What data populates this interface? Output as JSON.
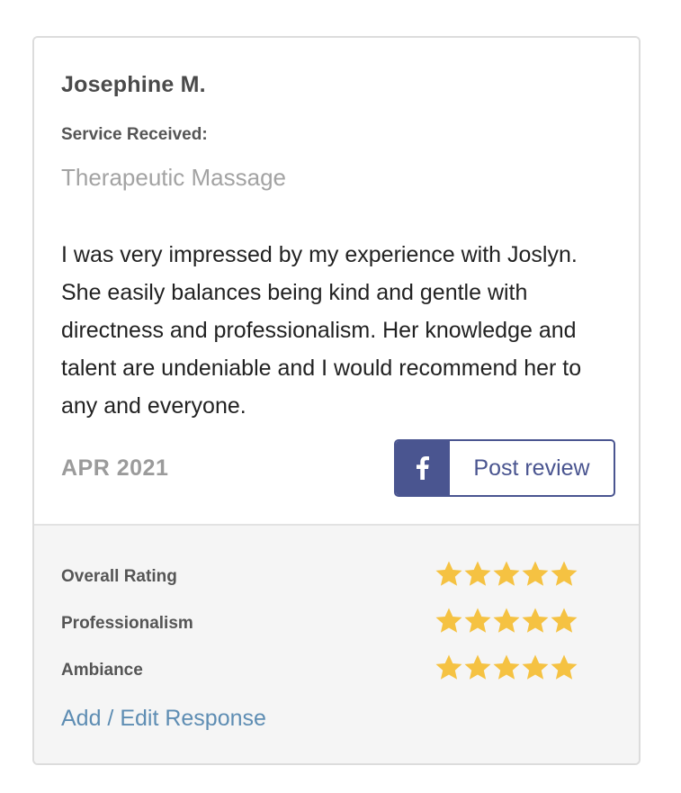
{
  "review": {
    "reviewer_name": "Josephine M.",
    "service_label": "Service Received:",
    "service_value": "Therapeutic Massage",
    "text": "I was very impressed by my experience with Joslyn. She easily balances being kind and gentle with directness and professionalism. Her knowledge and talent are undeniable and I would recommend her to any and everyone.",
    "date": "APR 2021",
    "post_button_label": "Post review",
    "post_button_icon": "facebook-icon"
  },
  "ratings": [
    {
      "label": "Overall Rating",
      "stars": 5,
      "max": 5
    },
    {
      "label": "Professionalism",
      "stars": 5,
      "max": 5
    },
    {
      "label": "Ambiance",
      "stars": 5,
      "max": 5
    }
  ],
  "response_link": "Add / Edit Response",
  "colors": {
    "facebook": "#4a5590",
    "star": "#f5c242",
    "link": "#5e8db3"
  }
}
